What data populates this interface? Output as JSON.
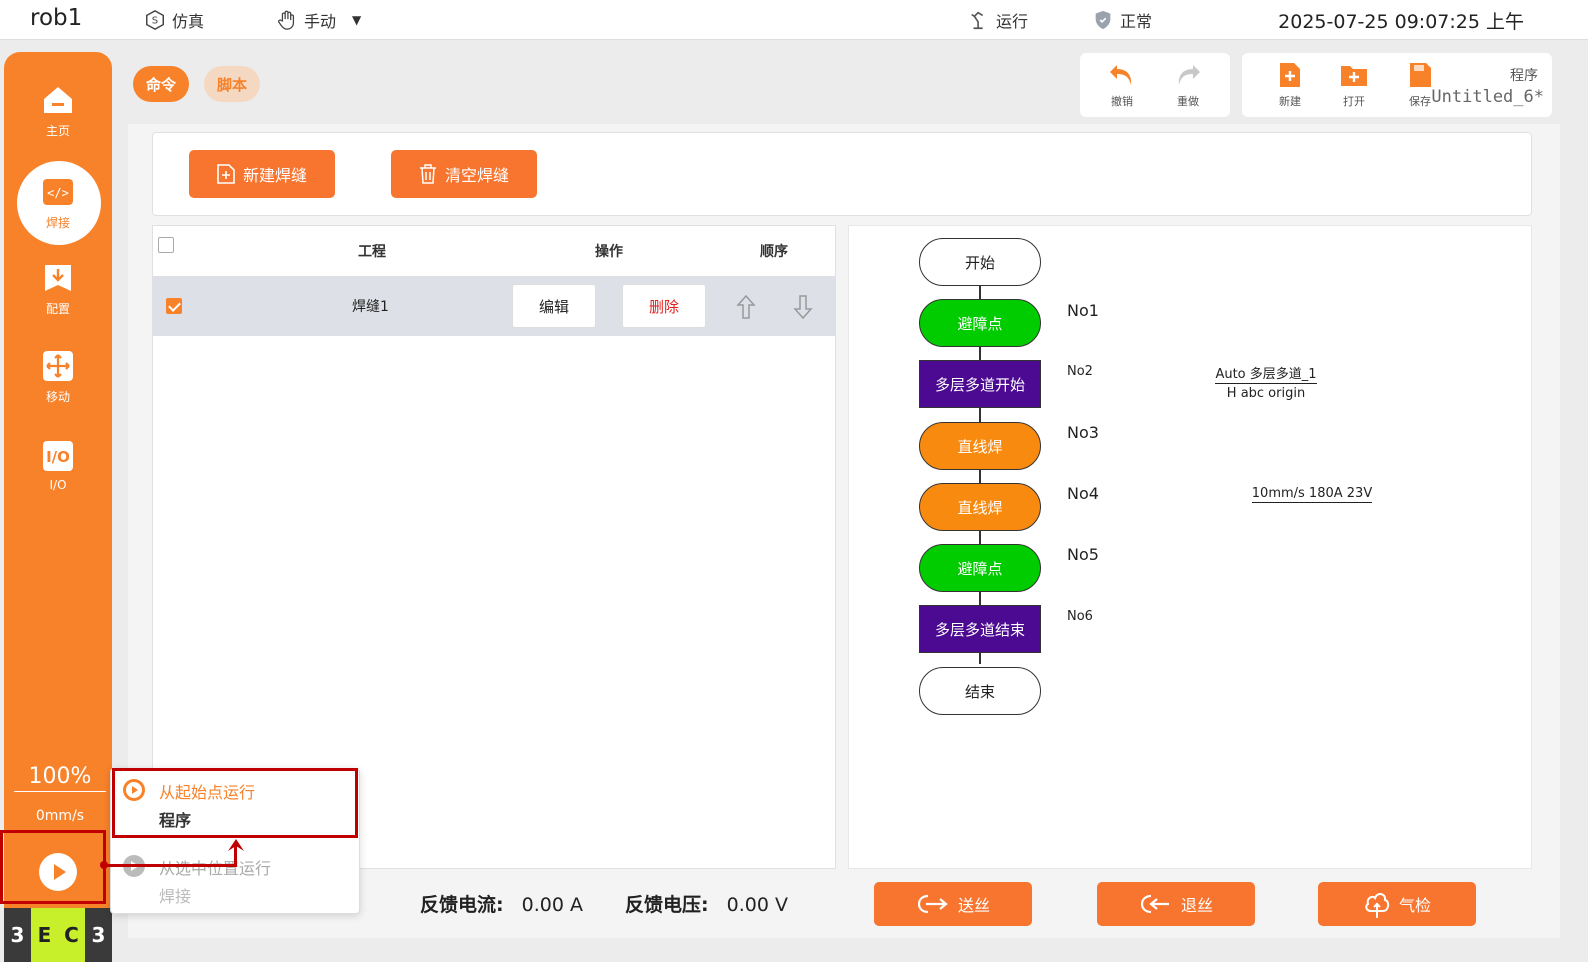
{
  "topbar": {
    "robot": "rob1",
    "sim_label": "仿真",
    "mode_label": "手动",
    "run_label": "运行",
    "status_label": "正常",
    "datetime": "2025-07-25 09:07:25 上午"
  },
  "sidebar": {
    "items": [
      {
        "label": "主页",
        "icon": "home-icon"
      },
      {
        "label": "焊接",
        "icon": "code-icon"
      },
      {
        "label": "配置",
        "icon": "download-icon"
      },
      {
        "label": "移动",
        "icon": "move-icon"
      },
      {
        "label": "I/O",
        "icon": "io-icon"
      }
    ],
    "speed_percent": "100%",
    "speed_mm": "0mm/s",
    "brand": [
      "3",
      "E",
      "C",
      "3"
    ]
  },
  "tabs": {
    "command": "命令",
    "script": "脚本"
  },
  "toolbar": {
    "undo": "撤销",
    "redo": "重做",
    "new": "新建",
    "open": "打开",
    "save": "保存",
    "program_label": "程序",
    "program_name": "Untitled_6*"
  },
  "actions": {
    "new_seam": "新建焊缝",
    "clear_seam": "清空焊缝"
  },
  "table": {
    "headers": {
      "project": "工程",
      "operation": "操作",
      "order": "顺序"
    },
    "rows": [
      {
        "name": "焊缝1",
        "edit": "编辑",
        "delete": "删除",
        "checked": true
      }
    ]
  },
  "flow": {
    "nodes": [
      {
        "label": "开始",
        "kind": "terminal"
      },
      {
        "label": "避障点",
        "kind": "green",
        "no": "No1"
      },
      {
        "label": "多层多道开始",
        "kind": "purple",
        "no": "No2"
      },
      {
        "label": "直线焊",
        "kind": "orange",
        "no": "No3"
      },
      {
        "label": "直线焊",
        "kind": "orange",
        "no": "No4"
      },
      {
        "label": "避障点",
        "kind": "green",
        "no": "No5"
      },
      {
        "label": "多层多道结束",
        "kind": "purple",
        "no": "No6"
      },
      {
        "label": "结束",
        "kind": "terminal"
      }
    ],
    "detail_no2_line1": "Auto 多层多道_1",
    "detail_no2_line2": "H abc origin",
    "detail_no4": "10mm/s 180A 23V"
  },
  "feedback": {
    "current_label": "反馈电流:",
    "current_value": "0.00 A",
    "voltage_label": "反馈电压:",
    "voltage_value": "0.00 V"
  },
  "bottom_buttons": {
    "feed": "送丝",
    "retract": "退丝",
    "gas": "气检"
  },
  "popup": {
    "item1_title": "从起始点运行",
    "item1_sub": "程序",
    "item2_title": "从选中位置运行",
    "item2_sub": "焊接"
  },
  "colors": {
    "accent": "#f7822a",
    "green_node": "#00cc00",
    "purple_node": "#4b0a91",
    "orange_node": "#f98a10",
    "annotation": "#c00000"
  }
}
